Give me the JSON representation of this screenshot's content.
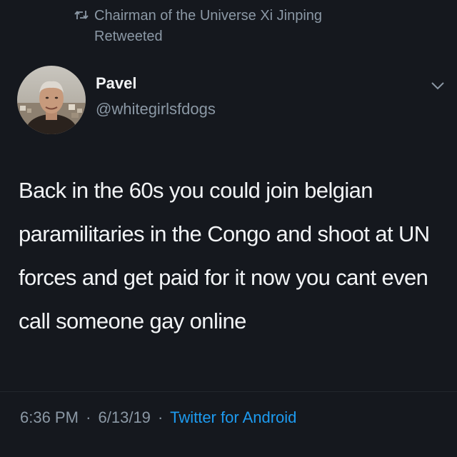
{
  "retweet": {
    "icon": "retweet-icon",
    "text": "Chairman of the Universe Xi Jinping Retweeted"
  },
  "author": {
    "display_name": "Pavel",
    "handle": "@whitegirlsfdogs",
    "avatar": "avatar-photo",
    "menu_icon": "chevron-down-icon"
  },
  "tweet": {
    "text": "Back in the 60s you could join belgian paramilitaries in the Congo and shoot at UN forces and get paid for it now you cant even call someone gay online"
  },
  "meta": {
    "time": "6:36 PM",
    "separator": "·",
    "date": "6/13/19",
    "source": "Twitter for Android"
  },
  "colors": {
    "background": "#15181e",
    "primary_text": "#f2f4f6",
    "secondary_text": "#8b98a5",
    "link": "#1d9bf0"
  }
}
